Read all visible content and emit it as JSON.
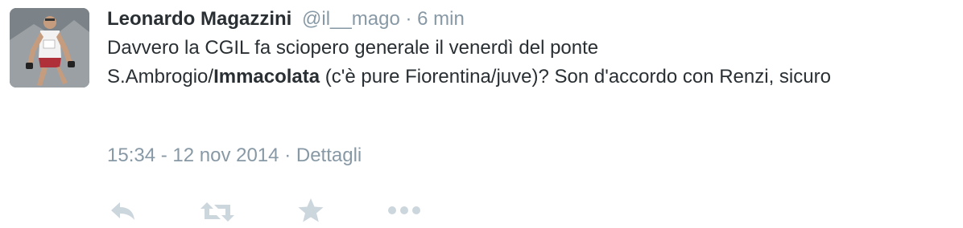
{
  "tweet": {
    "fullname": "Leonardo Magazzini",
    "username": "@il__mago",
    "separator": "·",
    "time_ago": "6 min",
    "text_line1": "Davvero la CGIL fa sciopero generale il venerdì del ponte",
    "text_part2_before": "S.Ambrogio/",
    "text_bold": "Immacolata",
    "text_part2_after": " (c'è pure Fiorentina/juve)? Son d'accordo con Renzi, sicuro",
    "timestamp": "15:34 - 12 nov 2014",
    "details_link": "Dettagli"
  },
  "icons": {
    "reply": "reply-icon",
    "retweet": "retweet-icon",
    "favorite": "star-icon",
    "more": "more-icon"
  },
  "colors": {
    "text": "#292f33",
    "secondary": "#8899a6",
    "icon": "#ccd6dd"
  }
}
